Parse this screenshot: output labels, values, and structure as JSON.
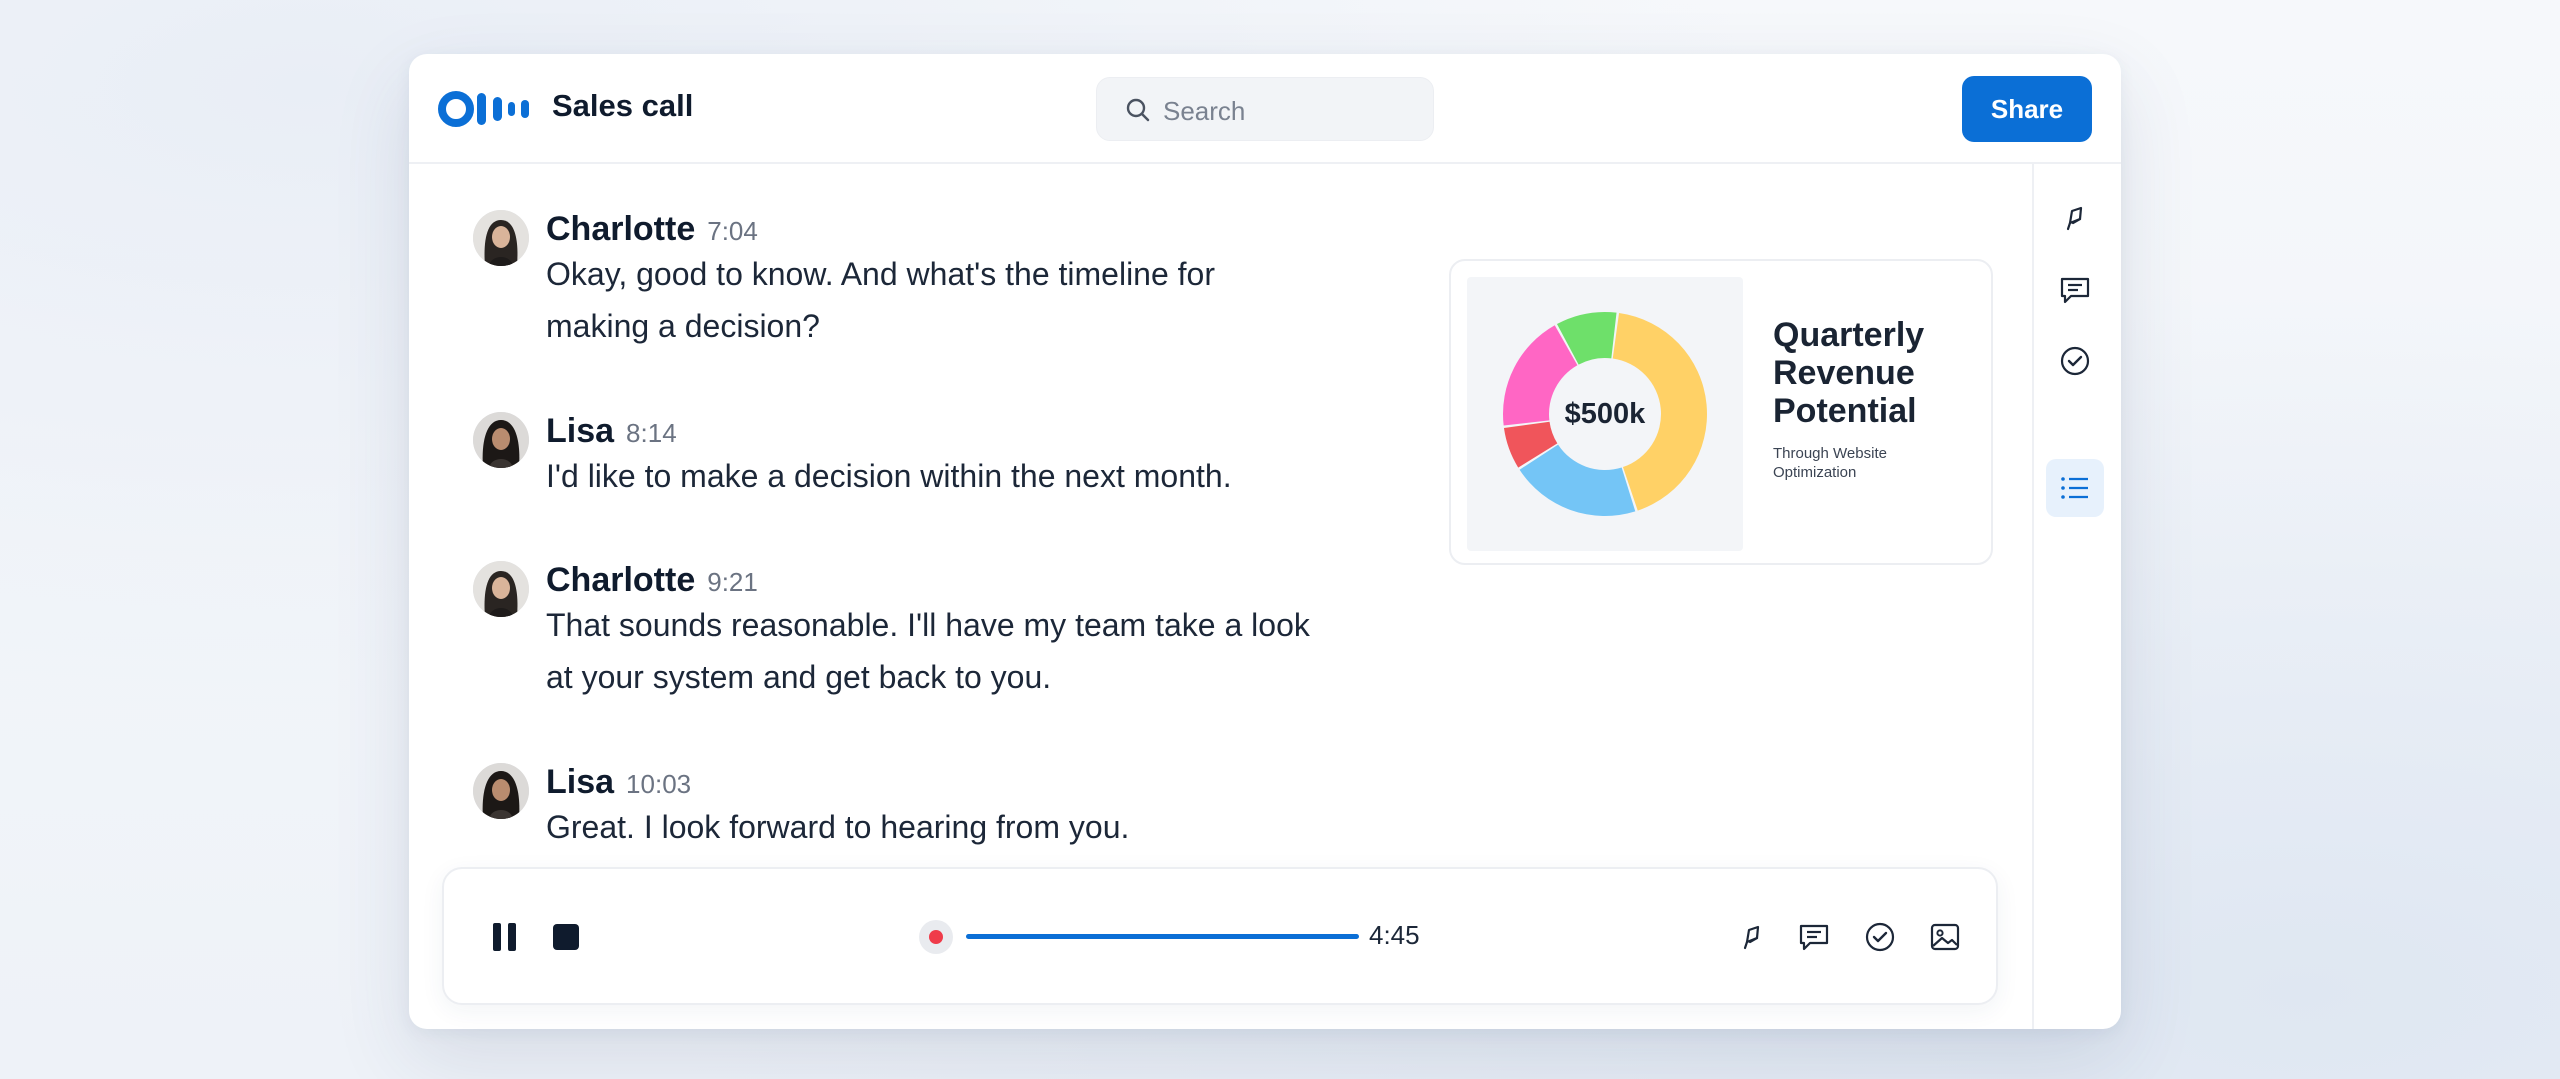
{
  "header": {
    "title": "Sales call",
    "search_placeholder": "Search",
    "share_label": "Share"
  },
  "messages": [
    {
      "speaker": "Charlotte",
      "time": "7:04",
      "lines": [
        "Okay, good to know. And what's the timeline for",
        "making a decision?"
      ]
    },
    {
      "speaker": "Lisa",
      "time": "8:14",
      "lines": [
        "I'd like to make a decision within the next month."
      ]
    },
    {
      "speaker": "Charlotte",
      "time": "9:21",
      "lines": [
        "That sounds reasonable. I'll have my team take a look",
        "at your system and get back to you."
      ]
    },
    {
      "speaker": "Lisa",
      "time": "10:03",
      "lines": [
        "Great. I look forward to hearing from you."
      ]
    }
  ],
  "slide": {
    "center_label": "$500k",
    "title_lines": [
      "Quarterly",
      "Revenue",
      "Potential"
    ],
    "subtitle_lines": [
      "Through Website",
      "Optimization"
    ]
  },
  "chart_data": {
    "type": "pie",
    "segments": [
      {
        "color": "#ffd166",
        "value": 43
      },
      {
        "color": "#74c5f6",
        "value": 21
      },
      {
        "color": "#f0555b",
        "value": 7
      },
      {
        "color": "#ff66c4",
        "value": 19
      },
      {
        "color": "#6ee06a",
        "value": 10
      }
    ]
  },
  "player": {
    "elapsed": "4:45"
  },
  "colors": {
    "accent": "#0b6fd6",
    "record": "#ef3b4a"
  },
  "icons": {
    "rail": [
      "highlight-icon",
      "comment-icon",
      "check-circle-icon",
      "list-icon"
    ],
    "player": [
      "pause-icon",
      "stop-icon",
      "highlight-icon",
      "comment-icon",
      "check-circle-icon",
      "image-icon"
    ]
  }
}
